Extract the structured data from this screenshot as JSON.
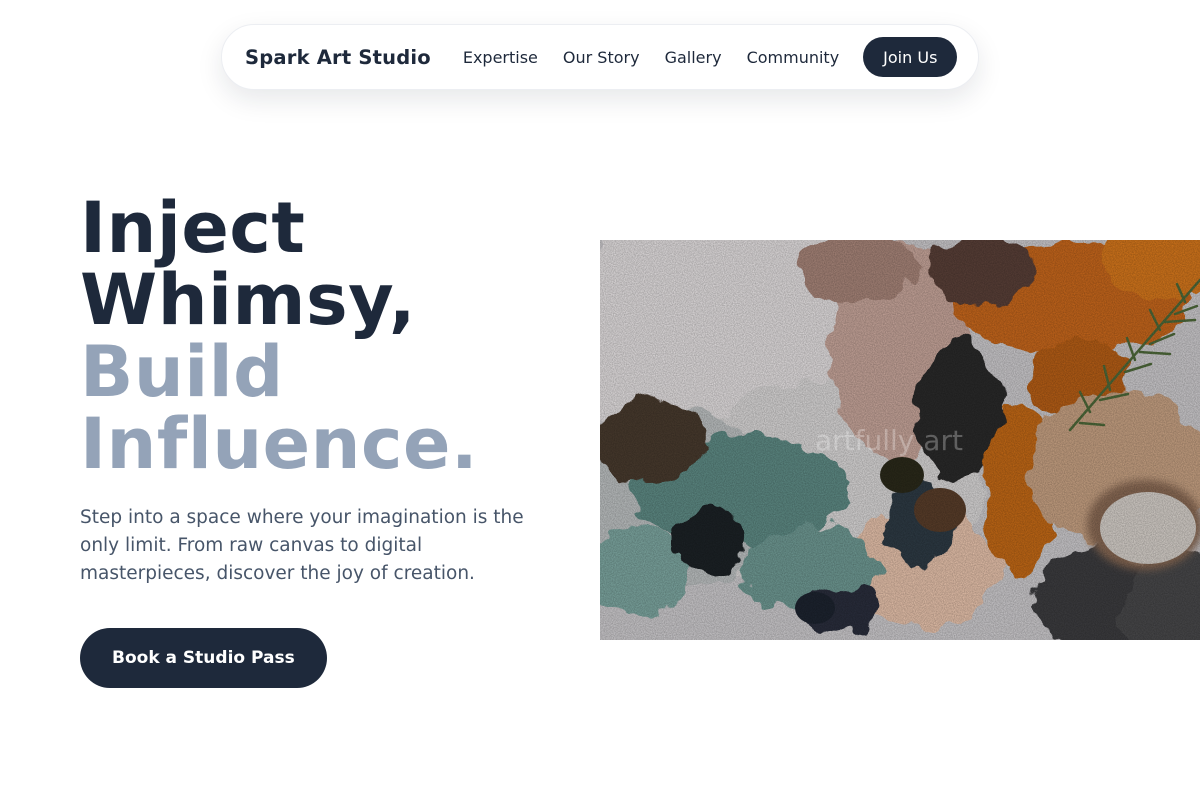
{
  "nav": {
    "brand": "Spark Art Studio",
    "links": [
      {
        "label": "Expertise"
      },
      {
        "label": "Our Story"
      },
      {
        "label": "Gallery"
      },
      {
        "label": "Community"
      }
    ],
    "join_label": "Join Us"
  },
  "hero": {
    "title_lines": [
      "Inject",
      "Whimsy,",
      "Build",
      "Influence."
    ],
    "description": "Step into a space where your imagination is the only limit. From raw canvas to digital masterpieces, discover the joy of creation.",
    "cta_label": "Book a Studio Pass",
    "image": {
      "subject": "textured-oil-paint-palette",
      "watermark": "artfully art"
    }
  },
  "colors": {
    "primary": "#1e293b",
    "muted_heading": "#94a3b8",
    "body_text": "#475569",
    "background": "#ffffff"
  }
}
